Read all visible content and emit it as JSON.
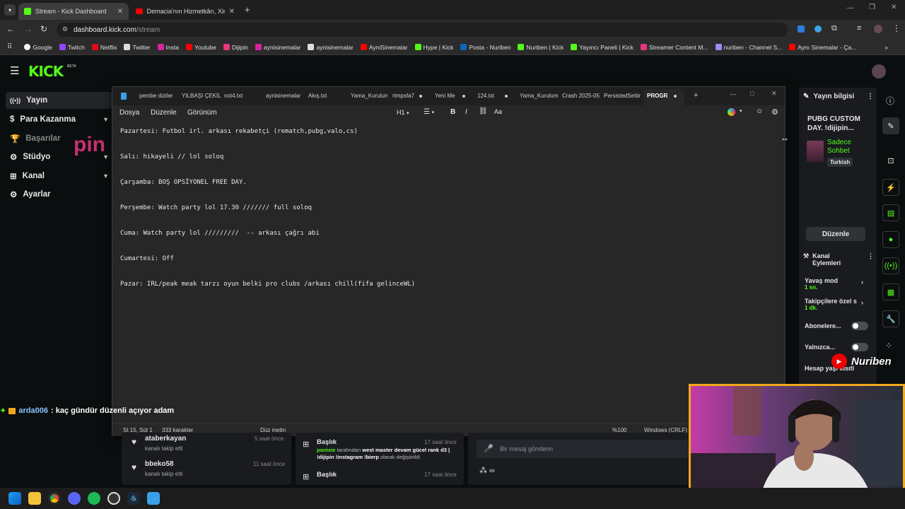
{
  "browser": {
    "tabs": [
      {
        "title": "Stream - Kick Dashboard",
        "active": true
      },
      {
        "title": "Demacia'nın Hizmetkârı, Xin Zh",
        "active": false
      }
    ],
    "url_host": "dashboard.kick.com",
    "url_path": "/stream",
    "bookmarks": [
      "Google",
      "Twitch",
      "Netflix",
      "Twitter",
      "Insta",
      "Youtube",
      "Dijipin",
      "aynisinemalar",
      "aynisinemalar",
      "AyniSinemalar",
      "Hype | Kick",
      "Posta - Nuriben",
      "Nuriben | Kick",
      "Yayıncı Paneli | Kick",
      "Streamer Content M...",
      "nuriben - Channel S...",
      "Aynı Sinemalar - Ça..."
    ]
  },
  "kick": {
    "logo": "KICK",
    "logo_beta": "BETA",
    "nav": [
      {
        "label": "Yayın",
        "icon": "broadcast-icon",
        "active": true,
        "chevron": false
      },
      {
        "label": "Para Kazanma",
        "icon": "dollar-icon",
        "active": false,
        "chevron": true
      },
      {
        "label": "Başarılar",
        "icon": "trophy-icon",
        "active": false,
        "chevron": false
      },
      {
        "label": "Stüdyo",
        "icon": "studio-icon",
        "active": false,
        "chevron": true
      },
      {
        "label": "Kanal",
        "icon": "channel-icon",
        "active": false,
        "chevron": true
      },
      {
        "label": "Ayarlar",
        "icon": "gear-icon",
        "active": false,
        "chevron": false
      }
    ],
    "watermark": "pin",
    "stream_info": {
      "header": "Yayın bilgisi",
      "title": "PUBG CUSTOM DAY. !dijipin...",
      "category": "Sadece Sohbet",
      "language": "Turkish",
      "edit_label": "Düzenle"
    },
    "channel_actions": {
      "header": "Kanal Eylemleri",
      "items": [
        {
          "label": "Yavaş mod",
          "value": "1 sn.",
          "type": "chevron"
        },
        {
          "label": "Takipçilere özel s",
          "value": "1 dk.",
          "type": "chevron"
        },
        {
          "label": "Abonelere...",
          "value": "",
          "type": "toggle"
        },
        {
          "label": "Yalnızca...",
          "value": "",
          "type": "toggle"
        },
        {
          "label": "Hesap yaşı kısıtl",
          "value": "",
          "type": "chevron"
        }
      ]
    },
    "overlay_brand": "Nuriben",
    "chat_overlay": {
      "user": "arda006",
      "message": ": kaç gündür düzenli açıyor adam"
    },
    "followers": [
      {
        "name": "ataberkayan",
        "sub": "kanalı takip etti",
        "time": "5 saat önce"
      },
      {
        "name": "bbeko58",
        "sub": "kanalı takip etti",
        "time": "11 saat önce"
      }
    ],
    "activity": [
      {
        "title": "Başlık",
        "time": "17 saat önce",
        "user": "ponixie",
        "mid": "tarafından",
        "text": "west master devam gücel rank d3 | !dijipin !instagram !bierp",
        "suffix": "olarak değiştirildi"
      },
      {
        "title": "Başlık",
        "time": "17 saat önce"
      }
    ],
    "chat_input_placeholder": "Bir mesaj gönderin"
  },
  "notepad": {
    "tabs": [
      "pembe diziler",
      "YILBAŞI ÇEKİLİ",
      "not4.txt",
      "aynisinemalar",
      "Akış.txt",
      "Yama_Kurulum",
      "rtmpsfa7",
      "Yeni Me",
      "124.txt",
      "Yama_Kurulum",
      "Crash 2025-05",
      "PersistedSettir",
      "PROGRA"
    ],
    "menu": [
      "Dosya",
      "Düzenle",
      "Görünüm"
    ],
    "heading": "H1",
    "lines": [
      "Pazartesi: Futbol irl. arkası rekabetçi (rematch,pubg,valo,cs)",
      "Salı: hikayeli // lol soloq",
      "Çarşamba: BOŞ OPSİYONEL FREE DAY.",
      "Perşembe: Watch party lol 17.30 /////// full soloq",
      "Cuma: Watch party lol /////////  -- arkası çağrı abi",
      "Cumartesi: Off",
      "Pazar: IRL/peak meak tarzı oyun belki pro clubs /arkası chill(fifa gelinceWL)"
    ],
    "status": {
      "position": "St 15, Süt 1",
      "chars": "333 karakter",
      "format": "Düz metin",
      "zoom": "%100",
      "eol": "Windows (CRLF)"
    }
  },
  "colors": {
    "kick_green": "#53fc18",
    "webcam_border": "#f2a71c"
  }
}
